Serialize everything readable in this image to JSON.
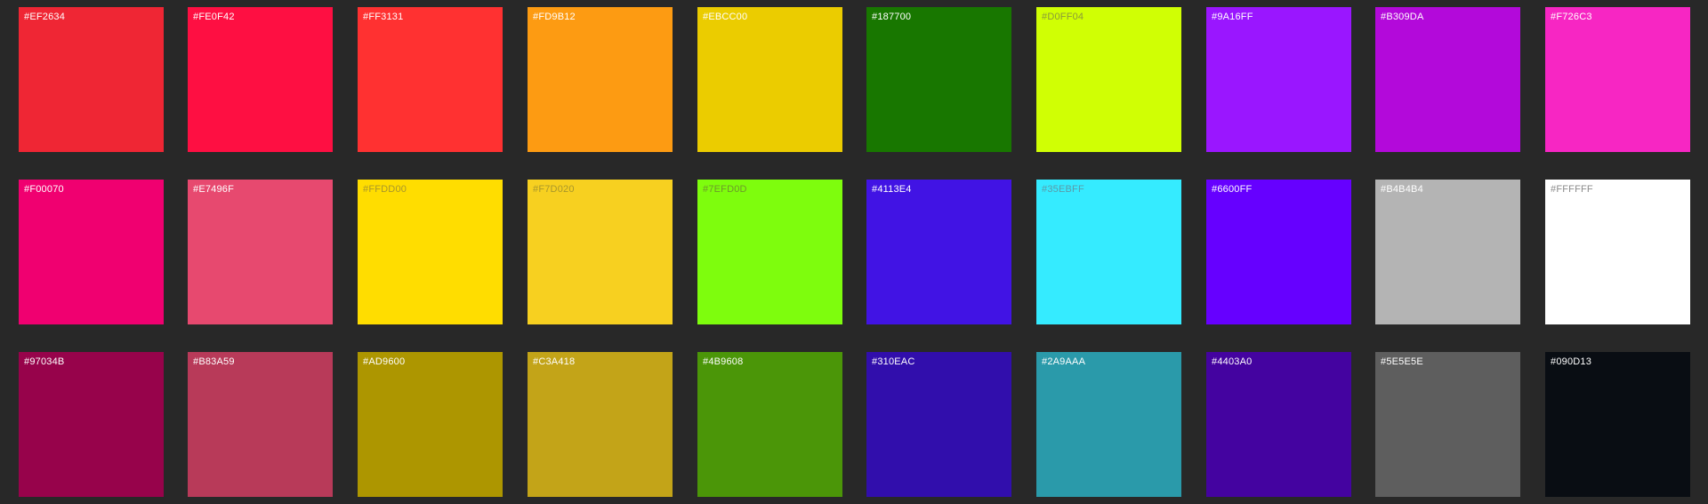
{
  "palette": {
    "rows": [
      {
        "swatches": [
          {
            "hex": "#EF2634",
            "label": "#EF2634",
            "text_color": "#FFFFFF"
          },
          {
            "hex": "#FE0F42",
            "label": "#FE0F42",
            "text_color": "#FFFFFF"
          },
          {
            "hex": "#FF3131",
            "label": "#FF3131",
            "text_color": "#FFFFFF"
          },
          {
            "hex": "#FD9B12",
            "label": "#FD9B12",
            "text_color": "#FFFFFF"
          },
          {
            "hex": "#EBCC00",
            "label": "#EBCC00",
            "text_color": "#FFFFFF"
          },
          {
            "hex": "#187700",
            "label": "#187700",
            "text_color": "#FFFFFF"
          },
          {
            "hex": "#D0FF04",
            "label": "#D0FF04",
            "text_color": "#8A9A3A"
          },
          {
            "hex": "#9A16FF",
            "label": "#9A16FF",
            "text_color": "#FFFFFF"
          },
          {
            "hex": "#B309DA",
            "label": "#B309DA",
            "text_color": "#FFFFFF"
          },
          {
            "hex": "#F726C3",
            "label": "#F726C3",
            "text_color": "#FFFFFF"
          }
        ]
      },
      {
        "swatches": [
          {
            "hex": "#F00070",
            "label": "#F00070",
            "text_color": "#FFFFFF"
          },
          {
            "hex": "#E7496F",
            "label": "#E7496F",
            "text_color": "#FFFFFF"
          },
          {
            "hex": "#FFDD00",
            "label": "#FFDD00",
            "text_color": "#A8962A"
          },
          {
            "hex": "#F7D020",
            "label": "#F7D020",
            "text_color": "#A8962A"
          },
          {
            "hex": "#7EFD0D",
            "label": "#7EFD0D",
            "text_color": "#6C9A2A"
          },
          {
            "hex": "#4113E4",
            "label": "#4113E4",
            "text_color": "#FFFFFF"
          },
          {
            "hex": "#35EBFF",
            "label": "#35EBFF",
            "text_color": "#5A9AA8"
          },
          {
            "hex": "#6600FF",
            "label": "#6600FF",
            "text_color": "#FFFFFF"
          },
          {
            "hex": "#B4B4B4",
            "label": "#B4B4B4",
            "text_color": "#FFFFFF"
          },
          {
            "hex": "#FFFFFF",
            "label": "#FFFFFF",
            "text_color": "#8A8A8A"
          }
        ]
      },
      {
        "swatches": [
          {
            "hex": "#97034B",
            "label": "#97034B",
            "text_color": "#FFFFFF"
          },
          {
            "hex": "#B83A59",
            "label": "#B83A59",
            "text_color": "#FFFFFF"
          },
          {
            "hex": "#AD9600",
            "label": "#AD9600",
            "text_color": "#FFFFFF"
          },
          {
            "hex": "#C3A418",
            "label": "#C3A418",
            "text_color": "#FFFFFF"
          },
          {
            "hex": "#4B9608",
            "label": "#4B9608",
            "text_color": "#FFFFFF"
          },
          {
            "hex": "#310EAC",
            "label": "#310EAC",
            "text_color": "#FFFFFF"
          },
          {
            "hex": "#2A9AAA",
            "label": "#2A9AAA",
            "text_color": "#FFFFFF"
          },
          {
            "hex": "#4403A0",
            "label": "#4403A0",
            "text_color": "#FFFFFF"
          },
          {
            "hex": "#5E5E5E",
            "label": "#5E5E5E",
            "text_color": "#FFFFFF"
          },
          {
            "hex": "#090D13",
            "label": "#090D13",
            "text_color": "#FFFFFF"
          }
        ]
      }
    ]
  }
}
